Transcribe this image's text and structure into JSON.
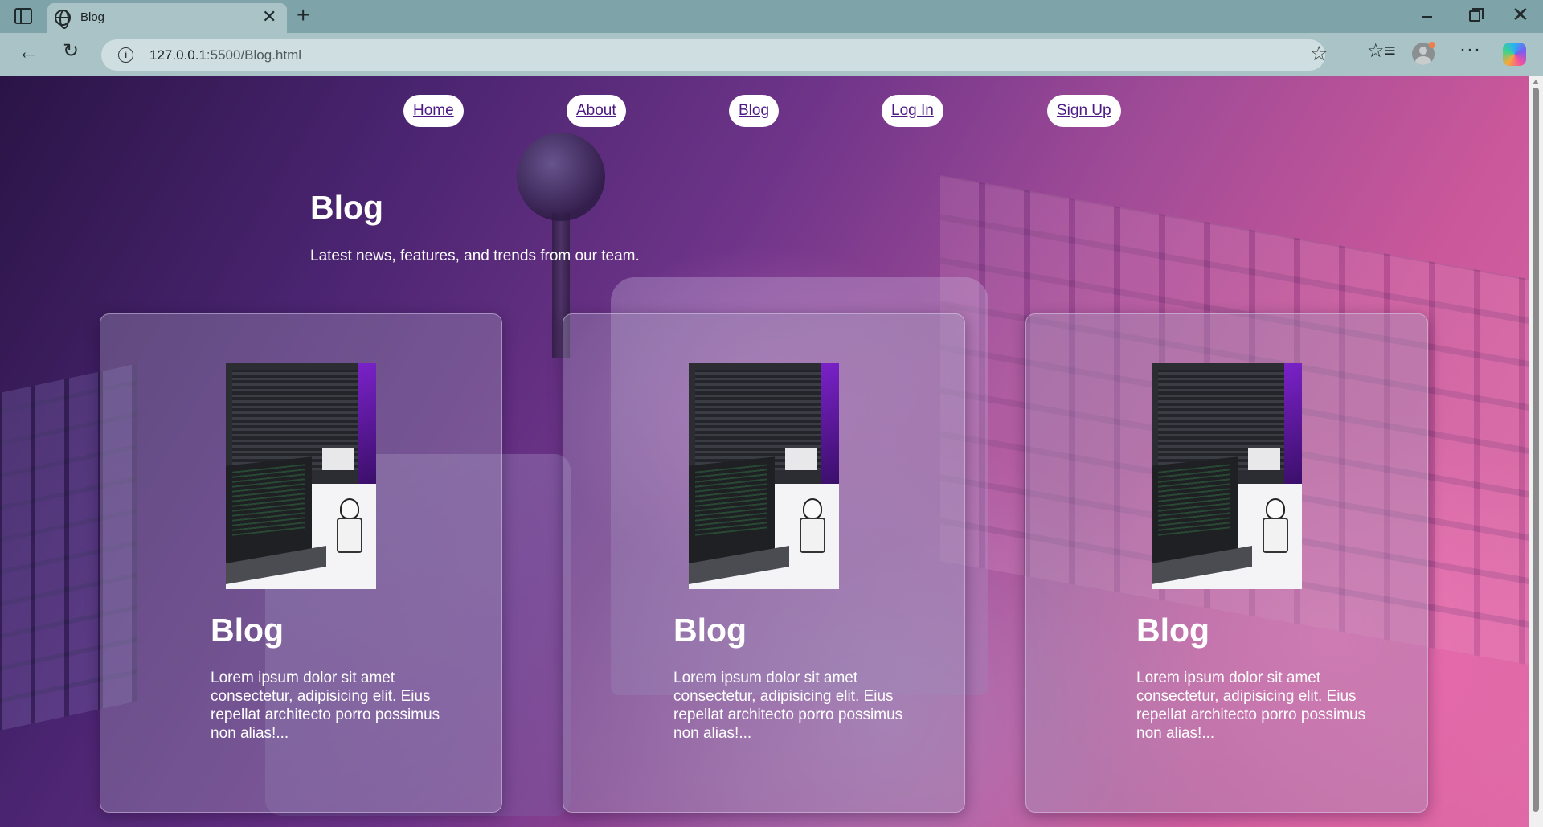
{
  "browser": {
    "tab_title": "Blog",
    "url_host": "127.0.0.1",
    "url_path": ":5500/Blog.html",
    "new_tab_glyph": "+",
    "close_glyph": "✕",
    "icons": [
      "sidebar-icon",
      "globe-icon",
      "close-icon",
      "plus-icon",
      "minimize-icon",
      "restore-icon",
      "back-icon",
      "reload-icon",
      "info-icon",
      "star-icon",
      "favorites-icon",
      "profile-icon",
      "more-icon",
      "copilot-icon"
    ]
  },
  "nav": {
    "items": [
      {
        "label": "Home"
      },
      {
        "label": "About"
      },
      {
        "label": "Blog"
      },
      {
        "label": "Log In"
      },
      {
        "label": "Sign Up"
      }
    ]
  },
  "hero": {
    "title": "Blog",
    "subtitle": "Latest news, features, and trends from our team."
  },
  "cards": [
    {
      "title": "Blog",
      "excerpt": "Lorem ipsum dolor sit amet consectetur, adipisicing elit. Eius repellat architecto porro possimus non alias!..."
    },
    {
      "title": "Blog",
      "excerpt": "Lorem ipsum dolor sit amet consectetur, adipisicing elit. Eius repellat architecto porro possimus non alias!..."
    },
    {
      "title": "Blog",
      "excerpt": "Lorem ipsum dolor sit amet consectetur, adipisicing elit. Eius repellat architecto porro possimus non alias!..."
    }
  ],
  "colors": {
    "nav_link": "#4b1a85",
    "tabbar": "#7ea3a9",
    "toolbar": "#a9c3c7"
  }
}
